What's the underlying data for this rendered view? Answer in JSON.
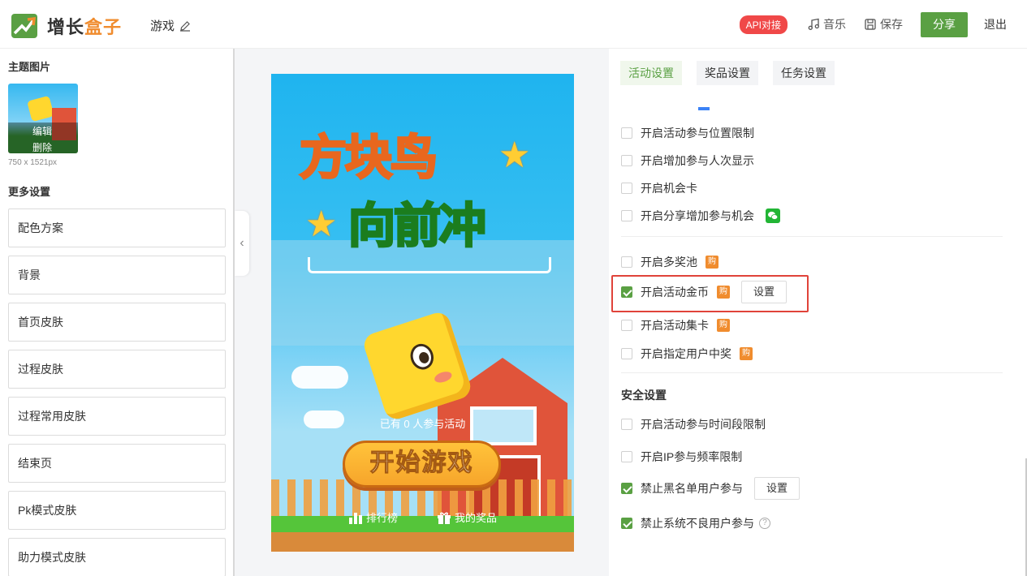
{
  "header": {
    "logo_text_a": "增长",
    "logo_text_b": "盒子",
    "game_name": "游戏",
    "api_badge": "API对接",
    "music": "音乐",
    "save": "保存",
    "share": "分享",
    "logout": "退出",
    "brand_color": "#5aa043"
  },
  "left": {
    "theme_title": "主题图片",
    "edit": "编辑",
    "delete": "删除",
    "image_size": "750 x 1521px",
    "more_title": "更多设置",
    "menu": [
      "配色方案",
      "背景",
      "首页皮肤",
      "过程皮肤",
      "过程常用皮肤",
      "结束页",
      "Pk模式皮肤",
      "助力模式皮肤"
    ]
  },
  "preview": {
    "title_line1": "方块鸟",
    "title_line2": "向前冲",
    "participants": "已有 0 人参与活动",
    "start": "开始游戏",
    "rank": "排行榜",
    "prizes": "我的奖品"
  },
  "right": {
    "tabs": [
      "活动设置",
      "奖品设置",
      "任务设置"
    ],
    "active_tab": "活动设置",
    "options_top": [
      {
        "label": "开启活动参与位置限制",
        "checked": false
      },
      {
        "label": "开启增加参与人次显示",
        "checked": false
      },
      {
        "label": "开启机会卡",
        "checked": false
      },
      {
        "label": "开启分享增加参与机会",
        "checked": false
      }
    ],
    "options_mid": [
      {
        "label": "开启多奖池",
        "checked": false,
        "buy": "购"
      },
      {
        "label": "开启活动金币",
        "checked": true,
        "buy": "购",
        "button": "设置"
      },
      {
        "label": "开启活动集卡",
        "checked": false,
        "buy": "购"
      },
      {
        "label": "开启指定用户中奖",
        "checked": false,
        "buy": "购"
      }
    ],
    "security_title": "安全设置",
    "options_security": [
      {
        "label": "开启活动参与时间段限制",
        "checked": false
      },
      {
        "label": "开启IP参与频率限制",
        "checked": false
      },
      {
        "label": "禁止黑名单用户参与",
        "checked": true,
        "button": "设置"
      },
      {
        "label": "禁止系统不良用户参与",
        "checked": true,
        "help": "?"
      }
    ]
  }
}
